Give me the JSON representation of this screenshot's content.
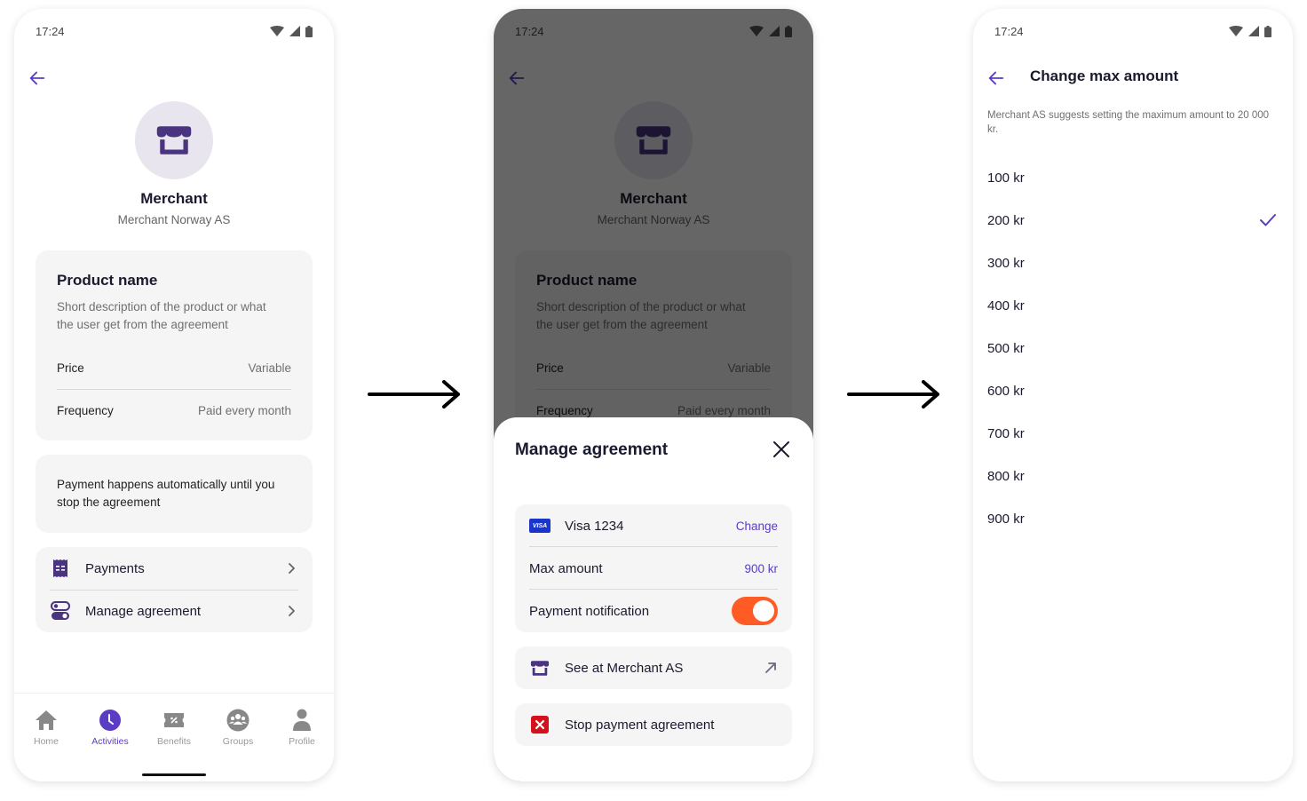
{
  "colors": {
    "accent": "#5b3cc4",
    "brand_dark": "#4a3480",
    "toggle_on": "#ff5b24",
    "danger": "#d4111a",
    "visa_blue": "#1a35c9"
  },
  "status_bar": {
    "time": "17:24",
    "icons": [
      "wifi-icon",
      "signal-icon",
      "battery-icon"
    ]
  },
  "screen1": {
    "back_icon": "arrow-left-icon",
    "merchant": {
      "icon": "storefront-icon",
      "name": "Merchant",
      "legal_name": "Merchant Norway AS"
    },
    "product": {
      "title": "Product name",
      "description": "Short description of the product or what the user get from the agreement",
      "rows": [
        {
          "label": "Price",
          "value": "Variable"
        },
        {
          "label": "Frequency",
          "value": "Paid every month"
        }
      ]
    },
    "info_text": "Payment happens automatically until you stop the agreement",
    "menu": [
      {
        "icon": "receipt-icon",
        "label": "Payments"
      },
      {
        "icon": "toggles-icon",
        "label": "Manage agreement"
      }
    ],
    "bottom_nav": [
      {
        "icon": "home-icon",
        "label": "Home",
        "active": false
      },
      {
        "icon": "clock-icon",
        "label": "Activities",
        "active": true
      },
      {
        "icon": "ticket-icon",
        "label": "Benefits",
        "active": false
      },
      {
        "icon": "group-icon",
        "label": "Groups",
        "active": false
      },
      {
        "icon": "person-icon",
        "label": "Profile",
        "active": false
      }
    ]
  },
  "screen2": {
    "sheet": {
      "title": "Manage agreement",
      "close_icon": "close-icon",
      "payment_method": {
        "badge": "VISA",
        "label": "Visa 1234",
        "action": "Change"
      },
      "max_amount": {
        "label": "Max amount",
        "value": "900 kr"
      },
      "notification": {
        "label": "Payment notification",
        "enabled": true
      },
      "see_at": {
        "icon": "storefront-icon",
        "label": "See at Merchant AS",
        "trailing_icon": "external-arrow-icon"
      },
      "stop": {
        "icon": "close-square-icon",
        "label": "Stop payment agreement"
      }
    }
  },
  "screen3": {
    "title": "Change max amount",
    "description": "Merchant AS suggests setting the maximum amount to 20 000 kr.",
    "options": [
      {
        "label": "100 kr",
        "selected": false
      },
      {
        "label": "200 kr",
        "selected": true
      },
      {
        "label": "300 kr",
        "selected": false
      },
      {
        "label": "400 kr",
        "selected": false
      },
      {
        "label": "500 kr",
        "selected": false
      },
      {
        "label": "600 kr",
        "selected": false
      },
      {
        "label": "700 kr",
        "selected": false
      },
      {
        "label": "800 kr",
        "selected": false
      },
      {
        "label": "900 kr",
        "selected": false
      }
    ]
  }
}
